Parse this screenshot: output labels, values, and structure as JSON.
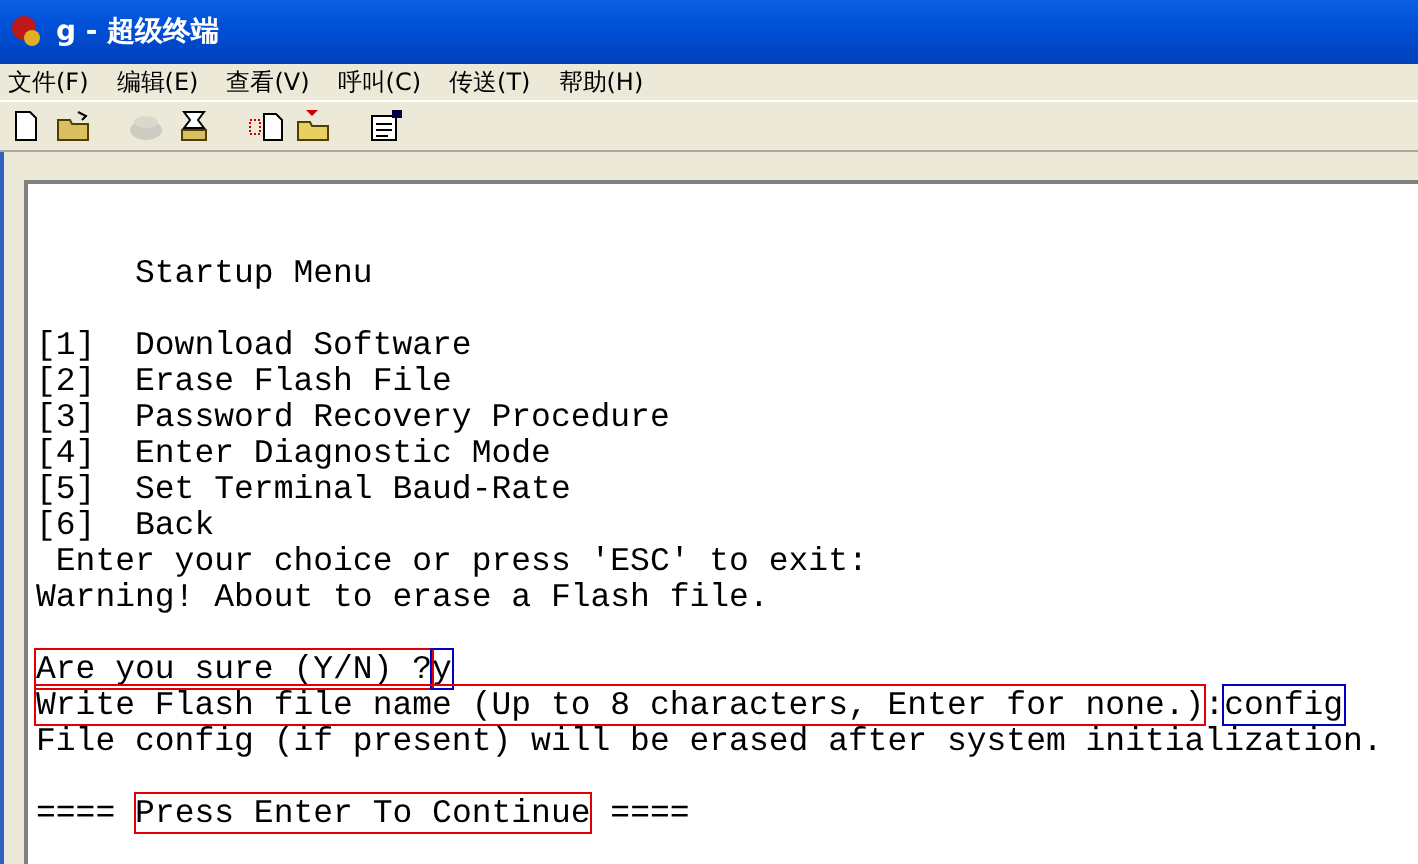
{
  "window": {
    "title": "g - 超级终端"
  },
  "menu": [
    "文件(F)",
    "编辑(E)",
    "查看(V)",
    "呼叫(C)",
    "传送(T)",
    "帮助(H)"
  ],
  "toolbar": [
    {
      "kind": "new",
      "disabled": false
    },
    {
      "kind": "open",
      "disabled": false
    },
    {
      "kind": "sep"
    },
    {
      "kind": "call",
      "disabled": true
    },
    {
      "kind": "hangup",
      "disabled": false
    },
    {
      "kind": "sep"
    },
    {
      "kind": "send",
      "disabled": false
    },
    {
      "kind": "receive",
      "disabled": false
    },
    {
      "kind": "sep"
    },
    {
      "kind": "properties",
      "disabled": false
    }
  ],
  "terminal": [
    {
      "kind": "blank"
    },
    {
      "kind": "blank"
    },
    {
      "kind": "text",
      "segments": [
        {
          "text": "     Startup Menu"
        }
      ]
    },
    {
      "kind": "blank"
    },
    {
      "kind": "text",
      "segments": [
        {
          "text": "[1]  Download Software"
        }
      ]
    },
    {
      "kind": "text",
      "segments": [
        {
          "text": "[2]  Erase Flash File"
        }
      ]
    },
    {
      "kind": "text",
      "segments": [
        {
          "text": "[3]  Password Recovery Procedure"
        }
      ]
    },
    {
      "kind": "text",
      "segments": [
        {
          "text": "[4]  Enter Diagnostic Mode"
        }
      ]
    },
    {
      "kind": "text",
      "segments": [
        {
          "text": "[5]  Set Terminal Baud-Rate"
        }
      ]
    },
    {
      "kind": "text",
      "segments": [
        {
          "text": "[6]  Back"
        }
      ]
    },
    {
      "kind": "text",
      "segments": [
        {
          "text": " Enter your choice or press 'ESC' to exit:"
        }
      ]
    },
    {
      "kind": "text",
      "segments": [
        {
          "text": "Warning! About to erase a Flash file."
        }
      ]
    },
    {
      "kind": "blank"
    },
    {
      "kind": "text",
      "segments": [
        {
          "text": "Are you sure (Y/N) ?",
          "color": "#e00000"
        },
        {
          "text": "y",
          "color": "#0000c0"
        }
      ]
    },
    {
      "kind": "text",
      "segments": [
        {
          "text": "Write Flash file name (Up to 8 characters, Enter for none.)",
          "color": "#e00000"
        },
        {
          "text": ":"
        },
        {
          "text": "config",
          "color": "#0000c0"
        }
      ]
    },
    {
      "kind": "text",
      "segments": [
        {
          "text": "File config (if present) will be erased after system initialization."
        }
      ]
    },
    {
      "kind": "blank"
    },
    {
      "kind": "text",
      "segments": [
        {
          "text": "==== "
        },
        {
          "text": "Press Enter To Continue",
          "color": "#e00000"
        },
        {
          "text": " ===="
        }
      ]
    }
  ]
}
